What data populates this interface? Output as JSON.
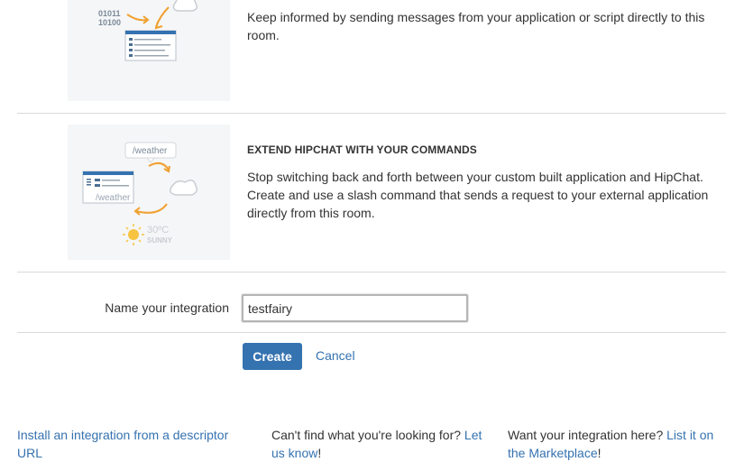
{
  "section_top": {
    "description": "Keep informed by sending messages from your application or script directly to this room.",
    "illustration": {
      "binary_line1": "01011",
      "binary_line2": "10100"
    }
  },
  "section_commands": {
    "title": "EXTEND HIPCHAT WITH YOUR COMMANDS",
    "description": "Stop switching back and forth between your custom built application and HipChat. Create and use a slash command that sends a request to your external application directly from this room.",
    "illustration": {
      "bubble_command": "/weather",
      "window_command": "/weather",
      "temperature": "30ºC",
      "condition": "SUNNY"
    }
  },
  "form": {
    "name_label": "Name your integration",
    "name_value": "testfairy",
    "create_label": "Create",
    "cancel_label": "Cancel"
  },
  "footer": {
    "col1_link": "Install an integration from a descriptor URL",
    "col2_text": "Can't find what you're looking for?",
    "col2_link": "Let us know",
    "col2_suffix": "!",
    "col3_text": "Want your integration here?",
    "col3_link": "List it on the Marketplace",
    "col3_suffix": "!"
  },
  "colors": {
    "accent": "#3572b0",
    "arrow": "#f0a030",
    "divider": "#d9d9d9"
  }
}
